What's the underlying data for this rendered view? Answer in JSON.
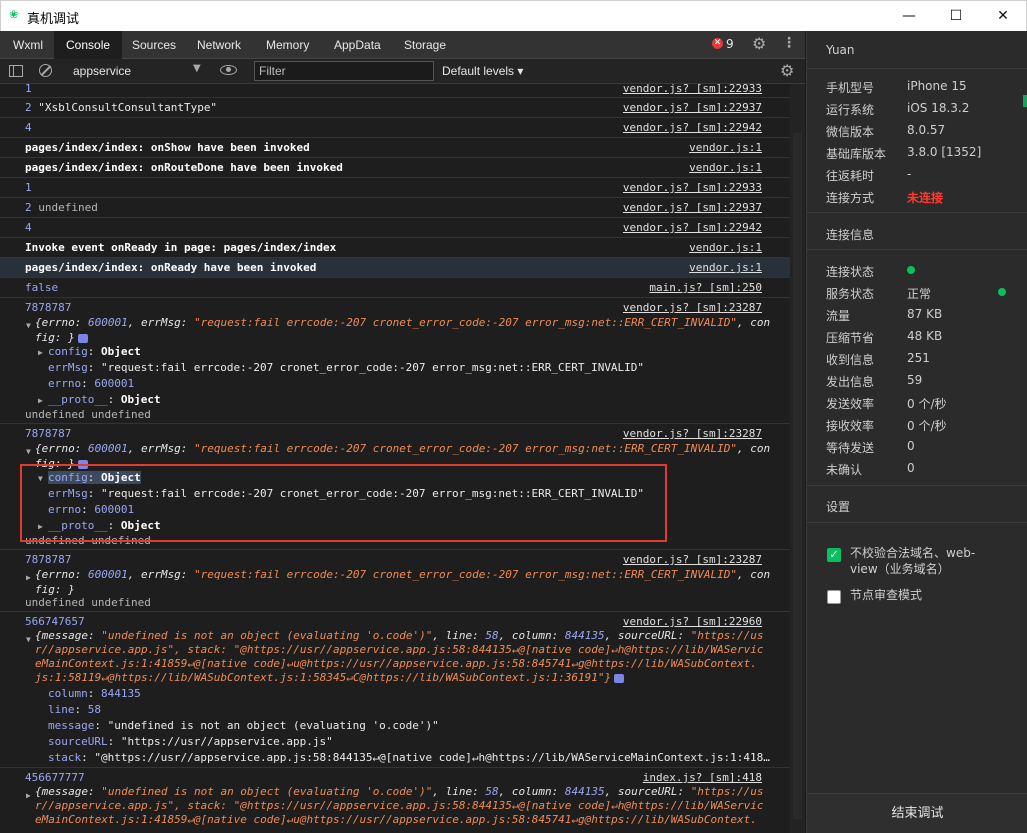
{
  "window": {
    "title": "真机调试",
    "minimize": "—",
    "maximize": "☐",
    "close": "✕"
  },
  "tabs": [
    "Wxml",
    "Console",
    "Sources",
    "Network",
    "Memory",
    "AppData",
    "Storage"
  ],
  "error_count": "9",
  "toolbar": {
    "context": "appservice",
    "filter_placeholder": "Filter",
    "levels": "Default levels"
  },
  "console": {
    "rows": [
      {
        "text": "1",
        "src": "vendor.js? [sm]:22933"
      },
      {
        "text_prefix": "2 ",
        "text_str": "\"XsblConsultConsultantType\"",
        "src": "vendor.js? [sm]:22937"
      },
      {
        "text": "4",
        "src": "vendor.js? [sm]:22942"
      },
      {
        "text": "pages/index/index: onShow have been invoked",
        "src": "vendor.js:1"
      },
      {
        "text": "pages/index/index: onRouteDone have been invoked",
        "src": "vendor.js:1"
      },
      {
        "text": "1",
        "src": "vendor.js? [sm]:22933"
      },
      {
        "text_prefix": "2 ",
        "text_str": "undefined",
        "src": "vendor.js? [sm]:22937"
      },
      {
        "text": "4",
        "src": "vendor.js? [sm]:22942"
      },
      {
        "text": "Invoke event onReady in page: pages/index/index",
        "src": "vendor.js:1"
      },
      {
        "text": "pages/index/index: onReady have been invoked",
        "src": "vendor.js:1"
      },
      {
        "text": "false",
        "src": "main.js? [sm]:250"
      }
    ],
    "err_block_1": {
      "id": "7878787",
      "src": "vendor.js? [sm]:23287",
      "line1_a": "{errno: ",
      "line1_num": "600001",
      "line1_b": ", errMsg: ",
      "line1_str": "\"request:fail errcode:-207 cronet_error_code:-207 error_msg:net::ERR_CERT_INVALID\"",
      "line1_c": ", con",
      "line2": "fig: }",
      "config_key": "config",
      "config_val": "Object",
      "errmsg_key": "errMsg",
      "errmsg_val": "\"request:fail errcode:-207 cronet_error_code:-207 error_msg:net::ERR_CERT_INVALID\"",
      "errno_key": "errno",
      "errno_val": "600001",
      "proto_key": "__proto__",
      "proto_val": "Object",
      "tail": "undefined undefined"
    },
    "err_block_2": {
      "id": "7878787",
      "src": "vendor.js? [sm]:23287",
      "tail": "undefined undefined"
    },
    "err_block_3": {
      "id": "7878787",
      "src": "vendor.js? [sm]:23287",
      "tail": "undefined undefined"
    },
    "msg_block_1": {
      "id": "566747657",
      "src": "vendor.js? [sm]:22960",
      "l1_a": "{message: ",
      "l1_str": "\"undefined is not an object (evaluating 'o.code')\"",
      "l1_b": ", line: ",
      "l1_num1": "58",
      "l1_c": ", column: ",
      "l1_num2": "844135",
      "l1_d": ", sourceURL: ",
      "l1_str2": "\"https://us",
      "l2": "r//appservice.app.js\", stack: \"@https://usr//appservice.app.js:58:844135↵@[native code]↵h@https://lib/WAServic",
      "l3": "eMainContext.js:1:41859↵@[native code]↵u@https://usr//appservice.app.js:58:845741↵g@https://lib/WASubContext.",
      "l4": "js:1:58119↵@https://lib/WASubContext.js:1:58345↵C@https://lib/WASubContext.js:1:36191\"}",
      "col_key": "column",
      "col_val": "844135",
      "line_key": "line",
      "line_val": "58",
      "message_key": "message",
      "message_val": "\"undefined is not an object (evaluating 'o.code')\"",
      "surl_key": "sourceURL",
      "surl_val": "\"https://usr//appservice.app.js\"",
      "stack_key": "stack",
      "stack_val": "\"@https://usr//appservice.app.js:58:844135↵@[native code]↵h@https://lib/WAServiceMainContext.js:1:418…"
    },
    "msg_block_2": {
      "id": "456677777",
      "src": "index.js? [sm]:418",
      "l2": "r//appservice.app.js\", stack: \"@https://usr//appservice.app.js:58:844135↵@[native code]↵h@https://lib/WAServic",
      "l3": "eMainContext.js:1:41859↵@[native code]↵u@https://usr//appservice.app.js:58:845741↵g@https://lib/WASubContext."
    }
  },
  "right_panel": {
    "user": "Yuan",
    "device": [
      {
        "label": "手机型号",
        "value": "iPhone 15"
      },
      {
        "label": "运行系统",
        "value": "iOS 18.3.2"
      },
      {
        "label": "微信版本",
        "value": "8.0.57"
      },
      {
        "label": "基础库版本",
        "value": "3.8.0 [1352]"
      },
      {
        "label": "往返耗时",
        "value": "-"
      },
      {
        "label": "连接方式",
        "value": "未连接"
      }
    ],
    "conn_title": "连接信息",
    "conn": [
      {
        "label": "连接状态",
        "value": ""
      },
      {
        "label": "服务状态",
        "value": "正常"
      },
      {
        "label": "流量",
        "value": "87 KB"
      },
      {
        "label": "压缩节省",
        "value": "48 KB"
      },
      {
        "label": "收到信息",
        "value": "251"
      },
      {
        "label": "发出信息",
        "value": "59"
      },
      {
        "label": "发送效率",
        "value": "0 个/秒"
      },
      {
        "label": "接收效率",
        "value": "0 个/秒"
      },
      {
        "label": "等待发送",
        "value": "0"
      },
      {
        "label": "未确认",
        "value": "0"
      }
    ],
    "settings_title": "设置",
    "opt1_line1": "不校验合法域名、web-",
    "opt1_line2": "view（业务域名）",
    "opt2": "节点审查模式",
    "end_button": "结束调试",
    "accent_green": "#07c160",
    "warn_red": "#ff3b30"
  }
}
